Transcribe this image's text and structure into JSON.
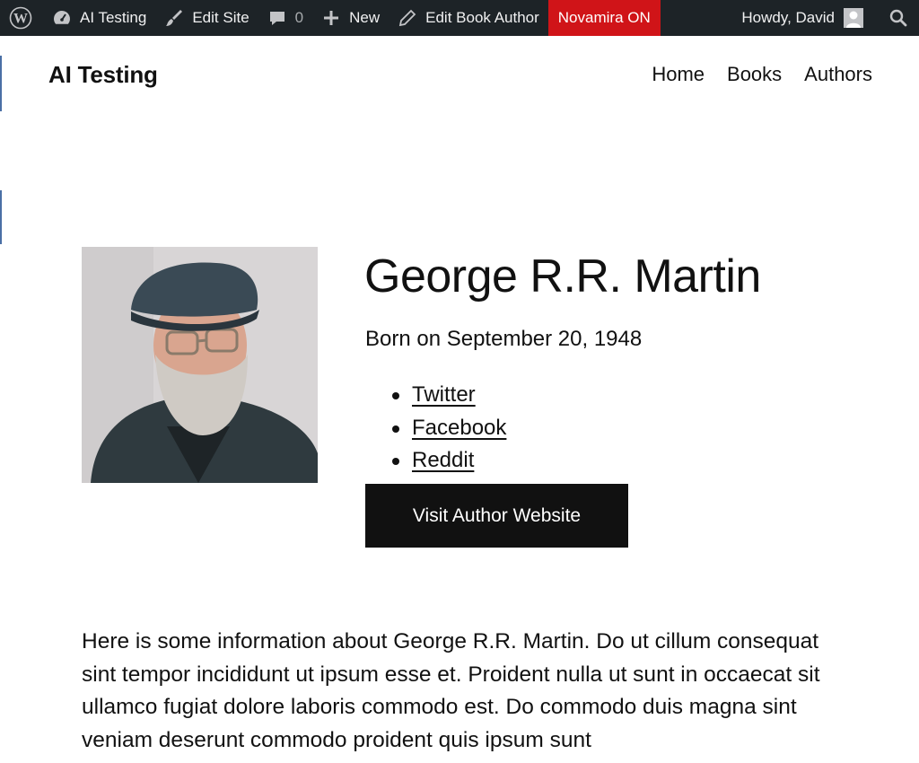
{
  "adminbar": {
    "wp_icon": "wordpress-logo-icon",
    "site_name": "AI Testing",
    "site_icon": "dashboard-gauge-icon",
    "edit_site": "Edit Site",
    "edit_site_icon": "brush-icon",
    "comments_count": "0",
    "comments_icon": "comment-bubble-icon",
    "new_label": "New",
    "new_icon": "plus-icon",
    "edit_book_author": "Edit Book Author",
    "edit_icon": "pencil-icon",
    "novamira": "Novamira ON",
    "howdy": "Howdy, David",
    "search_icon": "search-icon",
    "novamira_color": "#d01418",
    "bar_color": "#1d2327"
  },
  "header": {
    "site_title": "AI Testing",
    "nav": [
      {
        "label": "Home"
      },
      {
        "label": "Books"
      },
      {
        "label": "Authors"
      }
    ]
  },
  "author": {
    "name": "George R.R. Martin",
    "born": "Born on September 20, 1948",
    "links": [
      {
        "label": "Twitter"
      },
      {
        "label": "Facebook"
      },
      {
        "label": "Reddit"
      }
    ],
    "button_label": "Visit Author Website",
    "bio": "Here is some information about George R.R. Martin. Do ut cillum consequat sint tempor incididunt ut ipsum esse et. Proident nulla ut sunt in occaecat sit ullamco fugiat dolore laboris commodo est. Do commodo duis magna sint veniam deserunt commodo proident quis ipsum sunt"
  }
}
